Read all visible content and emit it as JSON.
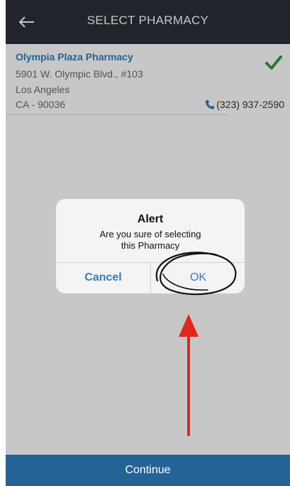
{
  "header": {
    "title": "SELECT PHARMACY",
    "back_icon": "arrow-left-icon"
  },
  "pharmacy": {
    "name": "Olympia Plaza Pharmacy",
    "address_line1": "5901 W. Olympic Blvd., #103",
    "address_line2": "Los Angeles",
    "address_line3": "CA  -  90036",
    "phone": "(323) 937-2590",
    "selected": true,
    "check_icon": "checkmark-icon",
    "phone_icon": "phone-icon"
  },
  "alert": {
    "title": "Alert",
    "message_line1": "Are you sure of selecting",
    "message_line2": "this Pharmacy",
    "cancel_label": "Cancel",
    "ok_label": "OK"
  },
  "footer": {
    "continue_label": "Continue"
  },
  "colors": {
    "header_bg": "#2b2f36",
    "accent": "#2f7fc1",
    "check": "#2e9b48",
    "annotation_arrow": "#e3261c"
  }
}
